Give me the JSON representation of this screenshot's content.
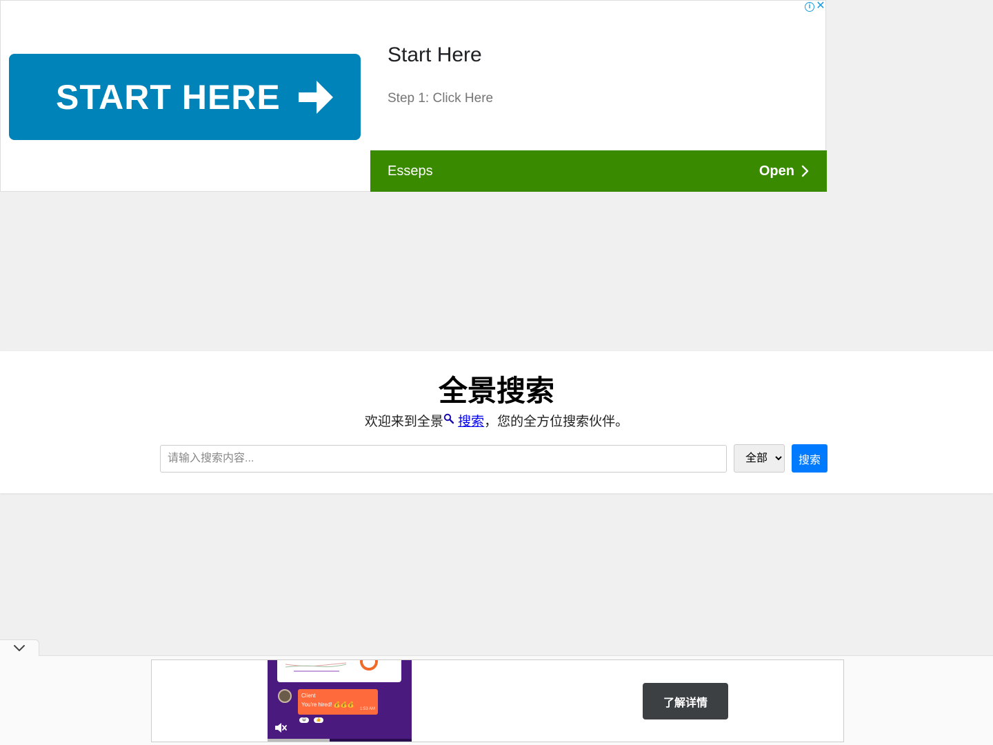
{
  "top_ad": {
    "banner_text": "START HERE",
    "title": "Start Here",
    "description": "Step 1: Click Here",
    "advertiser": "Esseps",
    "open_label": "Open",
    "info_glyph": "i",
    "close_glyph": "✕",
    "colors": {
      "banner": "#0083b8",
      "footer": "#3a8a00",
      "icons": "#1a9ae0"
    }
  },
  "search": {
    "title": "全景搜索",
    "tagline_prefix": "欢迎来到全景",
    "tagline_icon": "search-icon",
    "tagline_link": "搜索",
    "tagline_suffix": "，您的全方位搜索伙伴。",
    "input_placeholder": "请输入搜索内容...",
    "input_value": "",
    "category_selected": "全部",
    "button_label": "搜索",
    "colors": {
      "button": "#007bff"
    }
  },
  "bottom_ad": {
    "video": {
      "bubble_sender": "Client",
      "bubble_text": "You're hired! 💰💰💰",
      "bubble_time": "1:53 AM",
      "progress": 0.43
    },
    "cta_label": "了解详情",
    "collapse_icon": "chevron-down-icon",
    "mute_icon": "mute-icon"
  }
}
